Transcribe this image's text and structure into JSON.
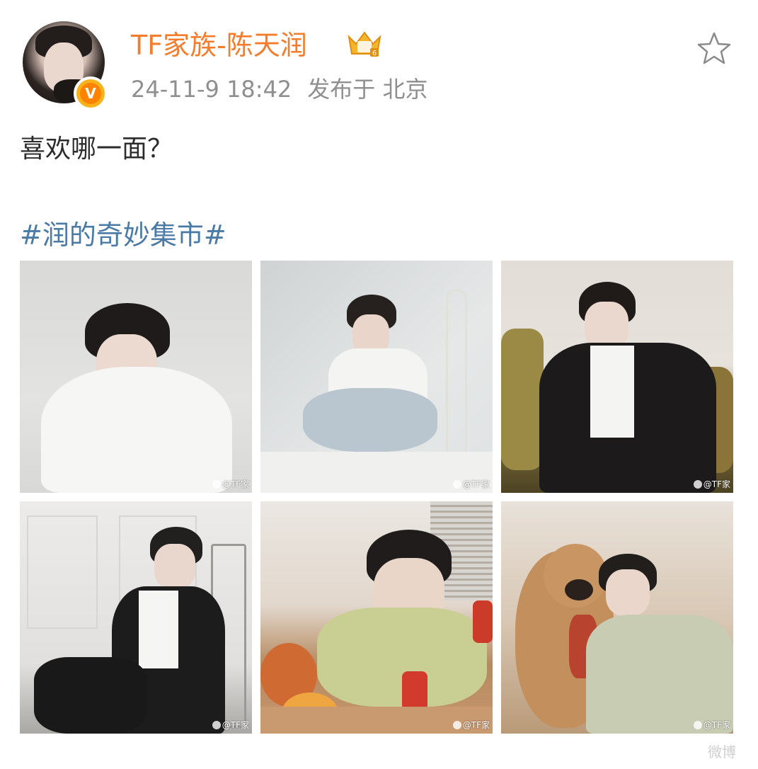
{
  "author": {
    "name": "TF家族-陈天润",
    "avatar_icon": "user-avatar",
    "verified_icon": "verified-v-icon",
    "verified_letter": "V",
    "member_badge_icon": "crown-badge-icon",
    "name_color": "#f47c2b"
  },
  "meta": {
    "time": "24-11-9 18:42",
    "location": "发布于 北京"
  },
  "actions": {
    "favorite_icon": "star-icon"
  },
  "post": {
    "text": "喜欢哪一面？",
    "hashtag": "#润的奇妙集市#",
    "hashtag_color": "#4a7aa6"
  },
  "photos": [
    {
      "watermark": "@TF家"
    },
    {
      "watermark": "@TF家"
    },
    {
      "watermark": "@TF家"
    },
    {
      "watermark": "@TF家"
    },
    {
      "watermark": "@TF家"
    },
    {
      "watermark": "@TF家"
    }
  ],
  "footer": {
    "watermark": "微博"
  }
}
